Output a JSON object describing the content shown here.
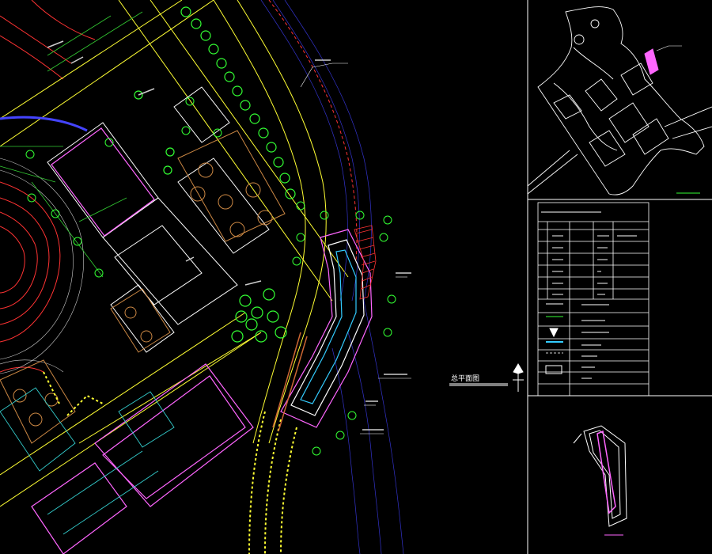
{
  "plan": {
    "title": "总平面图",
    "scale_note": "",
    "keyplan_label": "",
    "mini_label": ""
  },
  "table": {
    "heading": "",
    "rows": [
      {
        "a": "",
        "b": "",
        "c": ""
      },
      {
        "a": "",
        "b": "",
        "c": ""
      },
      {
        "a": "",
        "b": "",
        "c": ""
      },
      {
        "a": "",
        "b": "",
        "c": ""
      },
      {
        "a": "",
        "b": "",
        "c": ""
      },
      {
        "a": "",
        "b": "",
        "c": ""
      },
      {
        "a": "",
        "b": "",
        "c": ""
      }
    ],
    "legend": [
      "",
      "",
      "",
      "",
      "",
      ""
    ]
  },
  "colors": {
    "background": "#000000",
    "frame": "#ffffff",
    "building": "#ff66ff",
    "road": "#ffff33",
    "tree": "#33ff33",
    "contour": "#ff3333",
    "water": "#4444ff",
    "dim": "#00ffff",
    "hatch": "#ff3333",
    "label": "#33ff33"
  }
}
